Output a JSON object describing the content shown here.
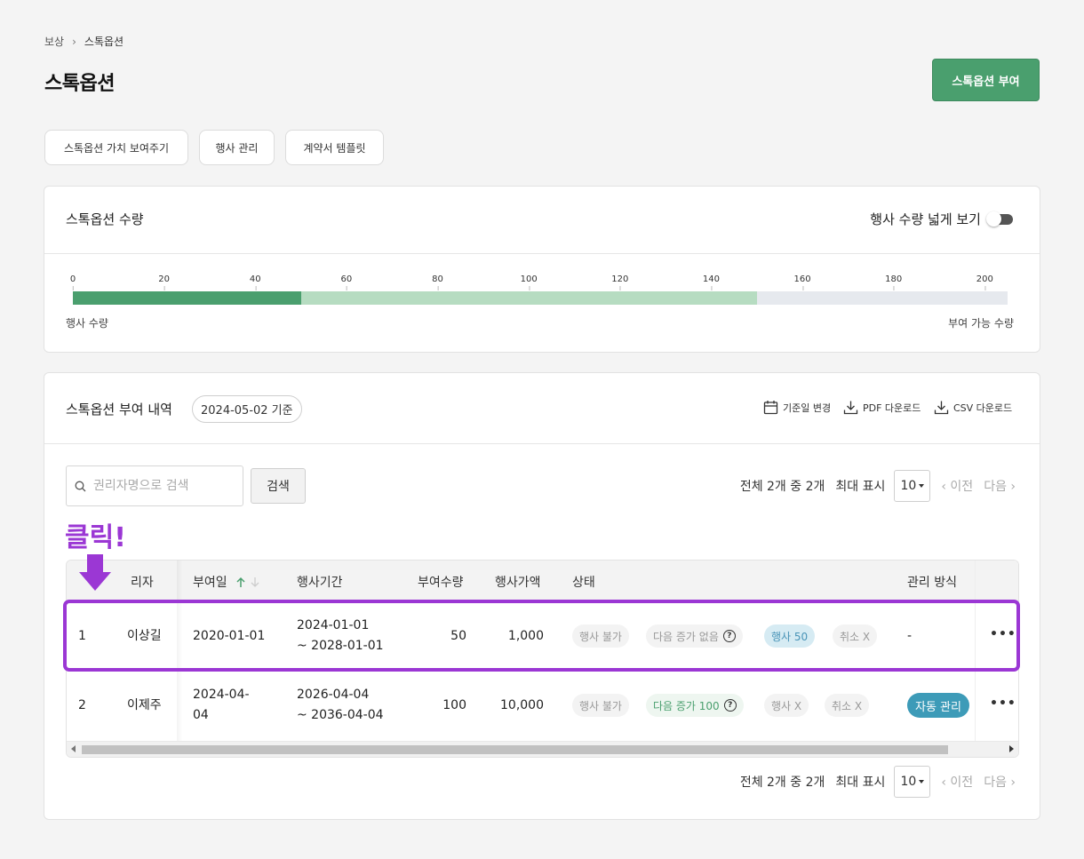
{
  "breadcrumb": {
    "parent": "보상",
    "current": "스톡옵션"
  },
  "page_title": "스톡옵션",
  "primary_button": "스톡옵션 부여",
  "sub_tabs": [
    "스톡옵션 가치 보여주기",
    "행사 관리",
    "계약서 템플릿"
  ],
  "quantity_card": {
    "title": "스톡옵션 수량",
    "toggle_label": "행사 수량 넓게 보기",
    "toggle_on": false,
    "axis_ticks": [
      "0",
      "20",
      "40",
      "60",
      "80",
      "100",
      "120",
      "140",
      "160",
      "180",
      "200"
    ],
    "axis_max": 205,
    "exercised_amount": 50,
    "granted_amount": 150,
    "left_label": "행사 수량",
    "right_label": "부여 가능 수량",
    "colors": {
      "exercised": "#4a9f6e",
      "granted": "#b6dcc1",
      "available": "#e6e9ee"
    }
  },
  "grant_card": {
    "title": "스톡옵션 부여 내역",
    "date_pill": "2024-05-02 기준",
    "actions": {
      "change_date": "기준일 변경",
      "pdf": "PDF 다운로드",
      "csv": "CSV 다운로드"
    },
    "search": {
      "placeholder": "권리자명으로 검색",
      "value": "",
      "button": "검색"
    },
    "pager": {
      "summary": "전체 2개 중 2개",
      "page_size_label": "최대 표시",
      "page_size": "10",
      "prev": "‹ 이전",
      "next": "다음 ›"
    },
    "columns": {
      "holder": "권리자",
      "grant_date": "부여일",
      "exercise_period": "행사기간",
      "quantity": "부여수량",
      "price": "행사가액",
      "status": "상태",
      "manage": "관리 방식"
    },
    "holder_header_visible": "리자",
    "rows": [
      {
        "no": "1",
        "holder": "이상길",
        "grant_date": "2020-01-01",
        "period_start": "2024-01-01",
        "period_end": "~ 2028-01-01",
        "quantity": "50",
        "price": "1,000",
        "status_exercise": "행사 불가",
        "status_next": "다음 증가 없음",
        "status_exercised": "행사 50",
        "status_cancel": "취소 X",
        "manage": "-"
      },
      {
        "no": "2",
        "holder": "이제주",
        "grant_date_line1": "2024-04-",
        "grant_date_line2": "04",
        "period_start": "2026-04-04",
        "period_end": "~ 2036-04-04",
        "quantity": "100",
        "price": "10,000",
        "status_exercise": "행사 불가",
        "status_next": "다음 증가 100",
        "status_exercised": "행사 X",
        "status_cancel": "취소 X",
        "manage": "자동 관리"
      }
    ],
    "more_label": "•••"
  },
  "annotation": {
    "label": "클릭!",
    "color": "#9b37d4"
  }
}
